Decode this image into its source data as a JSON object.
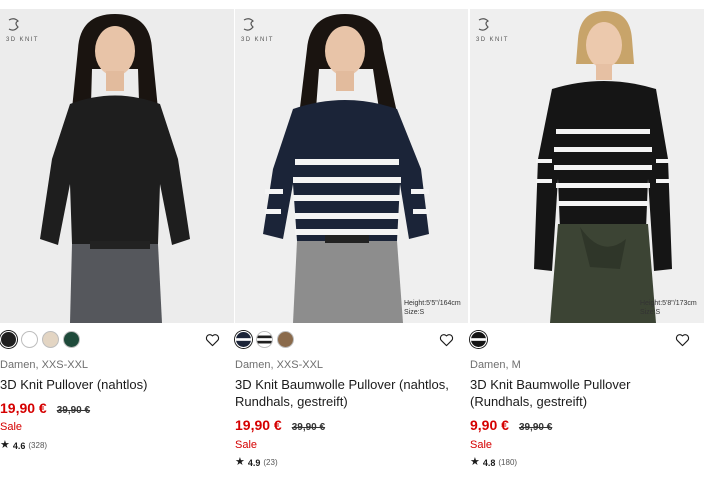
{
  "products": [
    {
      "brand": "3D KNIT",
      "model_info": "",
      "swatches": [
        "#1f1f1f",
        "#ffffff",
        "#e3d5c3",
        "#1e4a3a"
      ],
      "gender_size": "Damen, XXS-XXL",
      "title": "3D Knit Pullover (nahtlos)",
      "price": "19,90 €",
      "old_price": "39,90 €",
      "sale": "Sale",
      "rating": "4.6",
      "review_count": "(328)"
    },
    {
      "brand": "3D KNIT",
      "model_info": "Height:5'5\"/164cm Size:S",
      "swatches": [
        "stripe-navy",
        "stripe-black",
        "#8a6a4b"
      ],
      "gender_size": "Damen, XXS-XXL",
      "title": "3D Knit Baumwolle Pullover (nahtlos, Rundhals, gestreift)",
      "price": "19,90 €",
      "old_price": "39,90 €",
      "sale": "Sale",
      "rating": "4.9",
      "review_count": "(23)"
    },
    {
      "brand": "3D KNIT",
      "model_info": "Height:5'8\"/173cm Size:S",
      "swatches": [
        "stripe-black"
      ],
      "gender_size": "Damen, M",
      "title": "3D Knit Baumwolle Pullover (Rundhals, gestreift)",
      "price": "9,90 €",
      "old_price": "39,90 €",
      "sale": "Sale",
      "rating": "4.8",
      "review_count": "(180)"
    }
  ],
  "icons": {
    "favorite": "heart-outline-icon",
    "rating": "star-icon",
    "brand": "3d-knit-logo-icon"
  },
  "colors": {
    "sale_red": "#d50000",
    "text": "#1b1b1b",
    "muted": "#6f6f6f"
  }
}
